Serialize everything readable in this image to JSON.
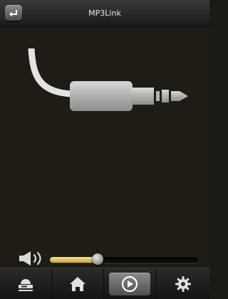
{
  "header": {
    "title": "MP3Link",
    "back_icon": "back-arrow-icon"
  },
  "main": {
    "graphic": "audio-cable-icon"
  },
  "volume": {
    "icon": "speaker-volume-icon",
    "level": 0.32,
    "fill_color": "#e6cf6e"
  },
  "nav": {
    "items": [
      {
        "icon": "device-icon",
        "active": false
      },
      {
        "icon": "home-icon",
        "active": false
      },
      {
        "icon": "play-icon",
        "active": true
      },
      {
        "icon": "gear-icon",
        "active": false
      }
    ]
  }
}
